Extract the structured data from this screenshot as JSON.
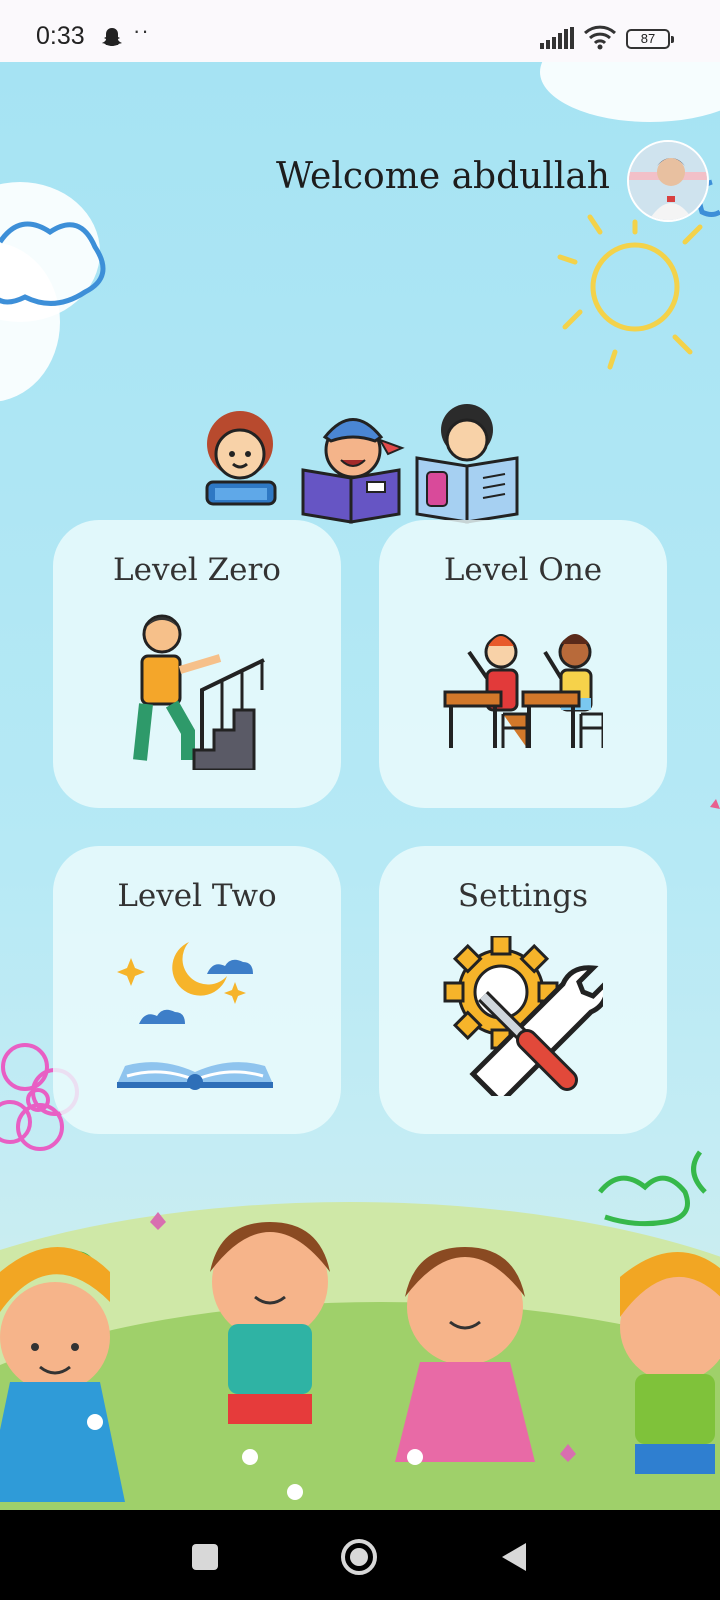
{
  "status_bar": {
    "time": "0:33",
    "dots": "··",
    "battery": "87"
  },
  "header": {
    "welcome": "Welcome abdullah"
  },
  "menu": {
    "level_zero": "Level Zero",
    "level_one": "Level One",
    "level_two": "Level Two",
    "settings": "Settings"
  },
  "icons": {
    "ghost": "snapchat-ghost-icon",
    "signal": "signal-icon",
    "wifi": "wifi-icon",
    "nav_recents": "square-icon",
    "nav_home": "circle-icon",
    "nav_back": "triangle-back-icon"
  },
  "colors": {
    "sky": "#a6e3f3",
    "card": "#ecfbfc",
    "grass": "#9fd06a"
  }
}
